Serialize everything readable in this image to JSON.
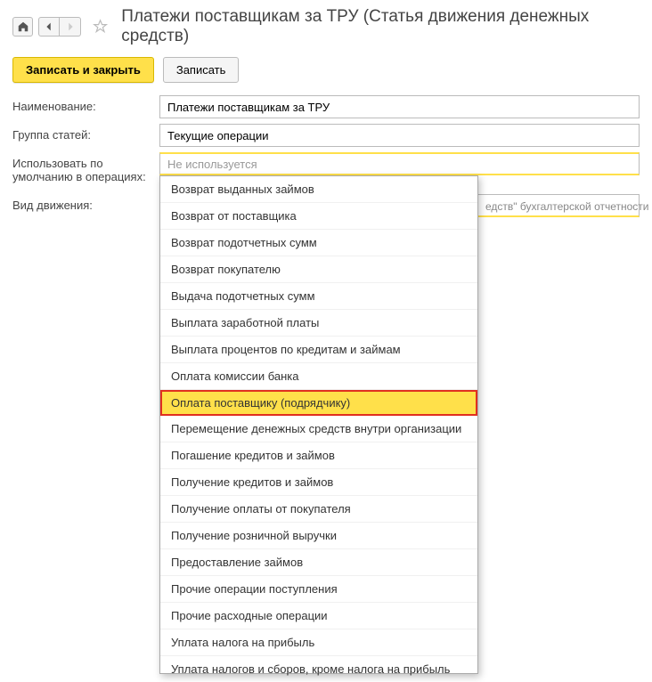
{
  "header": {
    "title": "Платежи поставщикам за ТРУ (Статья движения денежных средств)"
  },
  "toolbar": {
    "save_close_label": "Записать и закрыть",
    "save_label": "Записать"
  },
  "form": {
    "name_label": "Наименование:",
    "name_value": "Платежи поставщикам за ТРУ",
    "group_label": "Группа статей:",
    "group_value": "Текущие операции",
    "default_ops_label": "Использовать по умолчанию в операциях:",
    "default_ops_placeholder": "Не используется",
    "movement_label": "Вид движения:"
  },
  "hint": "едств\" бухгалтерской отчетности",
  "dropdown": {
    "items": [
      "Возврат выданных займов",
      "Возврат от поставщика",
      "Возврат подотчетных сумм",
      "Возврат покупателю",
      "Выдача подотчетных сумм",
      "Выплата заработной платы",
      "Выплата процентов по кредитам и займам",
      "Оплата комиссии банка",
      "Оплата поставщику (подрядчику)",
      "Перемещение денежных средств внутри организации",
      "Погашение кредитов и займов",
      "Получение кредитов и займов",
      "Получение оплаты от покупателя",
      "Получение розничной выручки",
      "Предоставление займов",
      "Прочие операции поступления",
      "Прочие расходные операции",
      "Уплата налога на прибыль",
      "Уплата налогов и сборов, кроме налога на прибыль"
    ],
    "selected_index": 8
  }
}
